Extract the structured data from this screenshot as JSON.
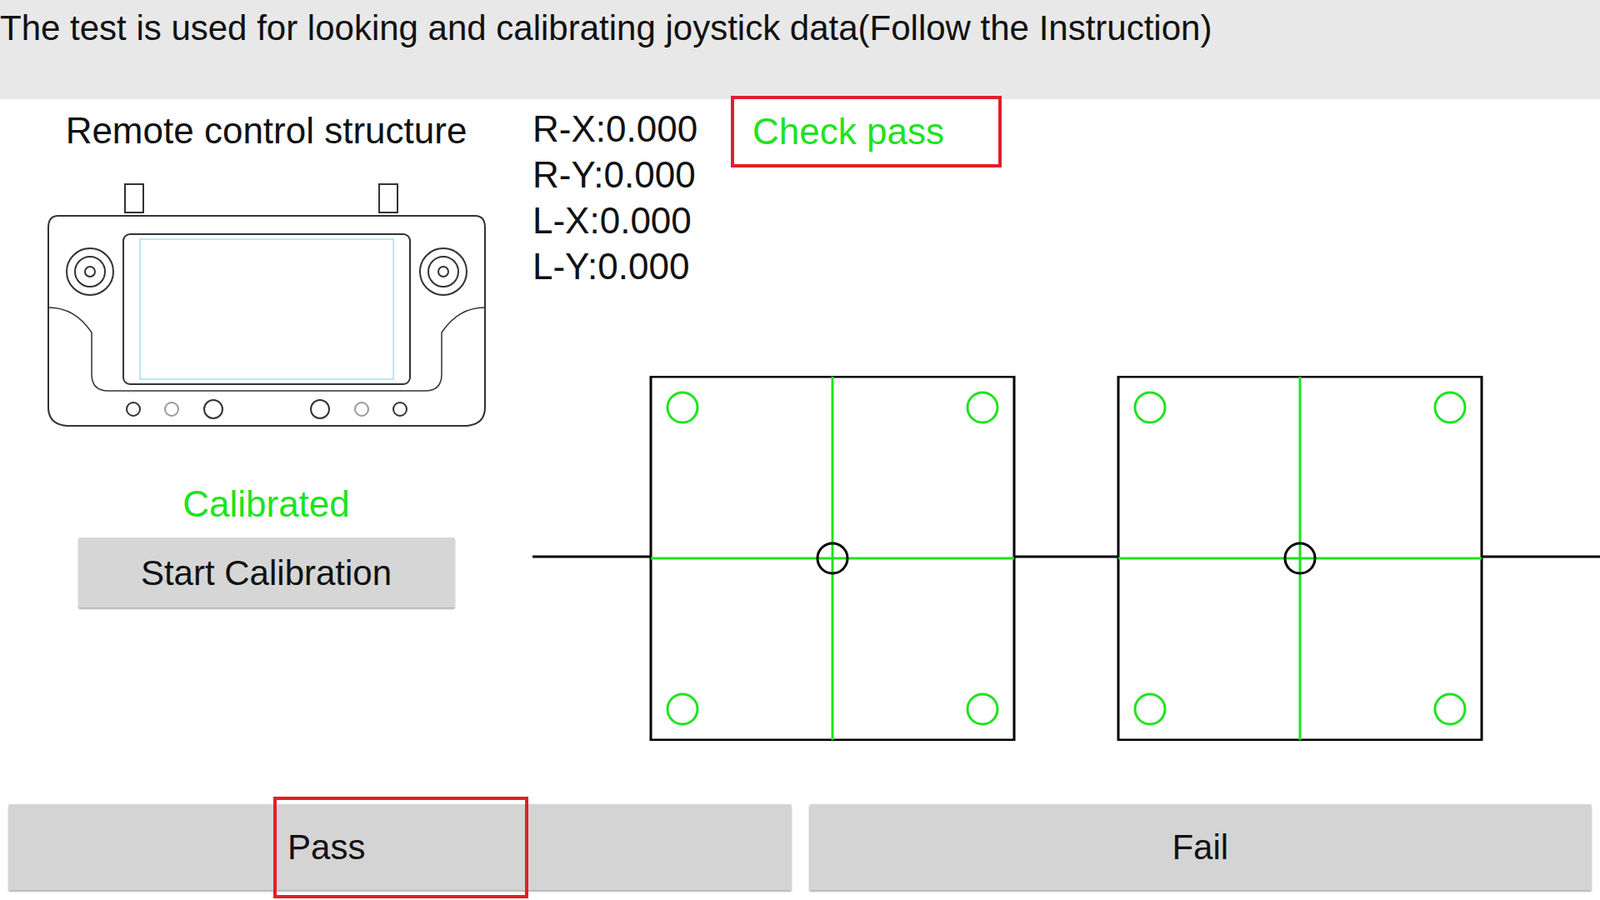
{
  "header": {
    "title": "The test is used for looking and calibrating joystick data(Follow the Instruction)"
  },
  "device": {
    "title": "Remote control structure",
    "status": "Calibrated",
    "calibrated": true,
    "button": "Start Calibration"
  },
  "readings": [
    "R-X:0.000",
    "R-Y:0.000",
    "L-X:0.000",
    "L-Y:0.000"
  ],
  "check": {
    "text": "Check pass",
    "passed": true,
    "highlighted": true
  },
  "joysticks": [
    {
      "x": 0,
      "y": 0,
      "corners_reached": [
        true,
        true,
        true,
        true
      ]
    },
    {
      "x": 0,
      "y": 0,
      "corners_reached": [
        true,
        true,
        true,
        true
      ]
    }
  ],
  "buttons": [
    {
      "label": "Pass",
      "highlighted": true
    },
    {
      "label": "Fail",
      "highlighted": false
    }
  ]
}
